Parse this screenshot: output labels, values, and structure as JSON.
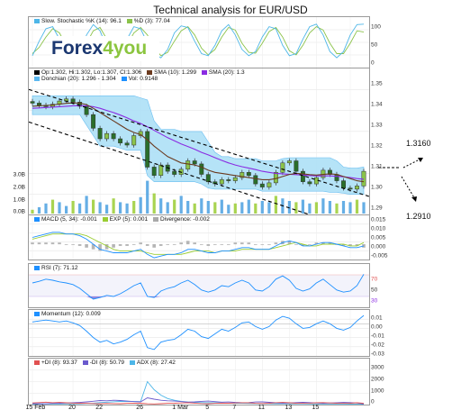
{
  "title": "Technical analysis for EUR/USD",
  "logo": {
    "part1": "Forex",
    "part2": "4you"
  },
  "stochastic": {
    "legend": [
      "Slow. Stochastic %K (14): 96.1",
      "%D (3): 77.04"
    ],
    "colors": [
      "#4db6e8",
      "#8bc34a"
    ],
    "ticks": [
      "100",
      "50",
      "0"
    ],
    "k": [
      20,
      55,
      85,
      90,
      60,
      30,
      15,
      25,
      70,
      95,
      80,
      40,
      20,
      30,
      60,
      90,
      85,
      50,
      25,
      15,
      35,
      75,
      92,
      88,
      55,
      25,
      20,
      45,
      80,
      95,
      70,
      35,
      20,
      30,
      65,
      90,
      85,
      45,
      20,
      25,
      60,
      90,
      96,
      70,
      30,
      15,
      30,
      70,
      95,
      96
    ],
    "d": [
      25,
      40,
      65,
      85,
      75,
      45,
      22,
      20,
      50,
      80,
      88,
      60,
      30,
      25,
      45,
      75,
      88,
      70,
      40,
      20,
      28,
      55,
      80,
      90,
      70,
      38,
      22,
      35,
      65,
      88,
      82,
      50,
      28,
      26,
      50,
      78,
      88,
      65,
      32,
      22,
      45,
      75,
      90,
      82,
      50,
      25,
      25,
      50,
      80,
      77
    ]
  },
  "price": {
    "legend_row1": [
      "Op:1.302, Hi:1.302, Lo:1.307, Cl:1.306",
      "SMA (10): 1.299",
      "SMA (20): 1.3"
    ],
    "legend_row2": [
      "Donchian (20): 1.296 - 1.304",
      "Vol: 0.9148"
    ],
    "legend_colors": [
      "#000000",
      "#6b3a1f",
      "#8a2be2",
      "#5bb8f0",
      "#1e90ff"
    ],
    "ticks": [
      "1.35",
      "1.34",
      "1.33",
      "1.32",
      "1.31",
      "1.30",
      "1.29"
    ],
    "vol_ticks": [
      "3.0B",
      "2.0B",
      "1.0B",
      "0.0B"
    ],
    "close": [
      1.3385,
      1.3375,
      1.3368,
      1.338,
      1.3395,
      1.3405,
      1.339,
      1.337,
      1.333,
      1.3265,
      1.3215,
      1.324,
      1.3215,
      1.3195,
      1.3185,
      1.323,
      1.325,
      1.308,
      1.304,
      1.309,
      1.306,
      1.3045,
      1.307,
      1.311,
      1.3095,
      1.3045,
      1.301,
      1.3,
      1.302,
      1.3015,
      1.303,
      1.3055,
      1.304,
      1.3,
      1.2985,
      1.3005,
      1.3055,
      1.31,
      1.311,
      1.306,
      1.301,
      1.3,
      1.303,
      1.3065,
      1.3045,
      1.3015,
      1.298,
      1.2975,
      1.299,
      1.306
    ],
    "donchian_high": [
      1.342,
      1.342,
      1.342,
      1.342,
      1.342,
      1.342,
      1.342,
      1.342,
      1.342,
      1.342,
      1.342,
      1.342,
      1.342,
      1.342,
      1.342,
      1.342,
      1.341,
      1.34,
      1.33,
      1.326,
      1.326,
      1.326,
      1.325,
      1.325,
      1.325,
      1.325,
      1.32,
      1.315,
      1.313,
      1.313,
      1.312,
      1.312,
      1.312,
      1.312,
      1.311,
      1.311,
      1.311,
      1.312,
      1.3125,
      1.3125,
      1.3125,
      1.3125,
      1.3125,
      1.3125,
      1.3125,
      1.311,
      1.308,
      1.3075,
      1.3075,
      1.308
    ],
    "donchian_low": [
      1.333,
      1.333,
      1.333,
      1.333,
      1.333,
      1.333,
      1.333,
      1.333,
      1.328,
      1.323,
      1.318,
      1.318,
      1.318,
      1.317,
      1.316,
      1.316,
      1.316,
      1.304,
      1.301,
      1.301,
      1.301,
      1.301,
      1.301,
      1.301,
      1.301,
      1.3,
      1.298,
      1.2975,
      1.2975,
      1.2975,
      1.2975,
      1.2975,
      1.2975,
      1.2975,
      1.2965,
      1.2965,
      1.2965,
      1.2965,
      1.2965,
      1.2965,
      1.2965,
      1.2965,
      1.2965,
      1.2965,
      1.296,
      1.296,
      1.2955,
      1.295,
      1.295,
      1.295
    ],
    "sma10": [
      1.337,
      1.3372,
      1.3374,
      1.3376,
      1.338,
      1.3384,
      1.3386,
      1.3385,
      1.3378,
      1.336,
      1.334,
      1.332,
      1.33,
      1.328,
      1.326,
      1.3245,
      1.3235,
      1.321,
      1.318,
      1.3155,
      1.313,
      1.3115,
      1.31,
      1.3095,
      1.309,
      1.308,
      1.3065,
      1.3055,
      1.305,
      1.3045,
      1.304,
      1.3035,
      1.303,
      1.3025,
      1.302,
      1.302,
      1.3025,
      1.3035,
      1.3045,
      1.305,
      1.3048,
      1.3044,
      1.3042,
      1.3045,
      1.3048,
      1.3045,
      1.3035,
      1.3025,
      1.3015,
      1.301
    ],
    "sma20": [
      1.336,
      1.3362,
      1.3364,
      1.3366,
      1.3368,
      1.337,
      1.3372,
      1.3373,
      1.3372,
      1.3368,
      1.336,
      1.335,
      1.334,
      1.3328,
      1.3315,
      1.33,
      1.3288,
      1.3272,
      1.3255,
      1.3238,
      1.322,
      1.3205,
      1.319,
      1.3178,
      1.3165,
      1.315,
      1.3138,
      1.3125,
      1.3112,
      1.31,
      1.309,
      1.3082,
      1.3075,
      1.3068,
      1.306,
      1.3055,
      1.305,
      1.3048,
      1.3046,
      1.3044,
      1.3042,
      1.304,
      1.3038,
      1.3038,
      1.3038,
      1.3036,
      1.3034,
      1.303,
      1.3025,
      1.3022
    ],
    "volume_b": [
      0.3,
      0.5,
      0.8,
      1.1,
      0.9,
      0.6,
      1.0,
      0.8,
      1.4,
      1.1,
      0.9,
      0.7,
      1.2,
      0.9,
      0.8,
      1.0,
      1.3,
      2.6,
      1.6,
      1.2,
      0.9,
      1.1,
      1.4,
      1.0,
      0.8,
      1.2,
      1.0,
      0.9,
      1.1,
      0.7,
      0.8,
      0.9,
      1.1,
      0.8,
      1.0,
      0.9,
      1.4,
      1.2,
      1.0,
      0.9,
      1.1,
      0.8,
      0.9,
      1.2,
      1.0,
      0.8,
      1.0,
      0.9,
      1.1,
      0.9
    ],
    "ylim": [
      1.285,
      1.355
    ],
    "trend_upper": [
      1.345,
      1.294
    ],
    "trend_lower": [
      1.3295,
      1.276
    ],
    "trend_pivot_label": "1.3160",
    "trend_target_label": "1.2910"
  },
  "macd": {
    "legend": [
      "MACD (5, 34): -0.001",
      "EXP (5): 0.001",
      "Divergence: -0.002"
    ],
    "colors": [
      "#1e90ff",
      "#9acd32",
      "#a9a9a9"
    ],
    "ticks": [
      "0.015",
      "0.010",
      "0.005",
      "0.000",
      "-0.005"
    ],
    "macd": [
      0.004,
      0.005,
      0.006,
      0.007,
      0.007,
      0.006,
      0.006,
      0.005,
      0.003,
      0.0,
      -0.003,
      -0.004,
      -0.005,
      -0.005,
      -0.005,
      -0.004,
      -0.003,
      -0.006,
      -0.008,
      -0.007,
      -0.006,
      -0.006,
      -0.005,
      -0.003,
      -0.003,
      -0.004,
      -0.005,
      -0.005,
      -0.004,
      -0.004,
      -0.003,
      -0.002,
      -0.002,
      -0.003,
      -0.003,
      -0.003,
      -0.001,
      0.001,
      0.002,
      0.001,
      -0.001,
      -0.001,
      0.0,
      0.001,
      0.001,
      0.0,
      -0.001,
      -0.002,
      -0.002,
      -0.001
    ],
    "signal": [
      0.003,
      0.004,
      0.005,
      0.006,
      0.006,
      0.006,
      0.006,
      0.006,
      0.005,
      0.003,
      0.001,
      -0.001,
      -0.003,
      -0.004,
      -0.004,
      -0.004,
      -0.004,
      -0.005,
      -0.006,
      -0.006,
      -0.006,
      -0.006,
      -0.006,
      -0.005,
      -0.004,
      -0.004,
      -0.004,
      -0.005,
      -0.004,
      -0.004,
      -0.004,
      -0.003,
      -0.003,
      -0.003,
      -0.003,
      -0.003,
      -0.002,
      -0.001,
      0.0,
      0.001,
      0.0,
      -0.001,
      -0.001,
      0.0,
      0.0,
      0.0,
      0.0,
      -0.001,
      -0.001,
      0.001
    ],
    "divergence": [
      0.001,
      0.001,
      0.001,
      0.001,
      0.001,
      0.0,
      0.0,
      -0.001,
      -0.002,
      -0.003,
      -0.004,
      -0.003,
      -0.002,
      -0.001,
      -0.001,
      0.0,
      0.001,
      -0.001,
      -0.002,
      -0.001,
      0.0,
      0.0,
      0.001,
      0.002,
      0.001,
      0.0,
      -0.001,
      0.0,
      0.0,
      0.0,
      0.001,
      0.001,
      0.001,
      0.0,
      0.0,
      0.0,
      0.001,
      0.002,
      0.002,
      0.0,
      -0.001,
      0.0,
      0.001,
      0.001,
      0.001,
      0.0,
      -0.001,
      -0.001,
      -0.001,
      -0.002
    ],
    "ylim": [
      -0.009,
      0.017
    ]
  },
  "rsi": {
    "legend": [
      "RSI (7): 71.12"
    ],
    "color": "#1e90ff",
    "ticks": [
      "70",
      "50",
      "30"
    ],
    "tick_colors": [
      "#e05050",
      "#333333",
      "#8a2be2"
    ],
    "values": [
      55,
      58,
      62,
      60,
      57,
      55,
      52,
      45,
      35,
      25,
      28,
      32,
      30,
      35,
      42,
      50,
      55,
      30,
      28,
      40,
      45,
      48,
      55,
      60,
      52,
      42,
      38,
      42,
      50,
      48,
      55,
      60,
      55,
      42,
      40,
      48,
      62,
      68,
      60,
      45,
      40,
      44,
      55,
      62,
      52,
      42,
      38,
      40,
      50,
      71
    ],
    "ylim": [
      10,
      90
    ]
  },
  "momentum": {
    "legend": [
      "Momentum (12): 0.009"
    ],
    "color": "#1e90ff",
    "ticks": [
      "0.01",
      "0.00",
      "-0.01",
      "-0.02",
      "-0.03"
    ],
    "values": [
      0.002,
      0.003,
      0.004,
      0.003,
      0.002,
      0.003,
      0.001,
      -0.002,
      -0.008,
      -0.015,
      -0.02,
      -0.018,
      -0.022,
      -0.02,
      -0.017,
      -0.012,
      -0.008,
      -0.026,
      -0.028,
      -0.02,
      -0.018,
      -0.017,
      -0.012,
      -0.006,
      -0.008,
      -0.014,
      -0.016,
      -0.011,
      -0.006,
      -0.008,
      -0.004,
      0.001,
      0.002,
      -0.003,
      -0.006,
      -0.003,
      0.004,
      0.008,
      0.006,
      0.0,
      -0.005,
      -0.004,
      0.0,
      0.003,
      0.0,
      -0.005,
      -0.007,
      -0.004,
      0.003,
      0.009
    ],
    "ylim": [
      -0.035,
      0.015
    ]
  },
  "adx": {
    "legend": [
      "+DI (8): 93.37",
      "-DI (8): 50.79",
      "ADX (8): 27.42"
    ],
    "colors": [
      "#e05050",
      "#6a5acd",
      "#4db6e8"
    ],
    "ticks": [
      "3000",
      "2000",
      "1000",
      "0"
    ],
    "plus_di": [
      120,
      150,
      180,
      140,
      160,
      130,
      110,
      100,
      90,
      80,
      70,
      85,
      75,
      70,
      90,
      110,
      100,
      60,
      50,
      70,
      90,
      100,
      120,
      140,
      110,
      80,
      70,
      90,
      110,
      100,
      120,
      140,
      130,
      90,
      80,
      100,
      140,
      160,
      130,
      100,
      90,
      110,
      130,
      150,
      120,
      100,
      90,
      100,
      130,
      93
    ],
    "minus_di": [
      80,
      70,
      60,
      90,
      100,
      120,
      140,
      160,
      200,
      250,
      300,
      280,
      320,
      300,
      260,
      220,
      200,
      500,
      400,
      320,
      280,
      260,
      220,
      180,
      200,
      240,
      260,
      220,
      180,
      190,
      160,
      140,
      150,
      190,
      200,
      170,
      130,
      110,
      120,
      150,
      170,
      150,
      120,
      100,
      120,
      140,
      160,
      150,
      120,
      50
    ],
    "adx_vals": [
      40,
      42,
      45,
      48,
      50,
      55,
      60,
      70,
      85,
      110,
      150,
      180,
      210,
      230,
      240,
      230,
      220,
      1700,
      1100,
      700,
      450,
      320,
      240,
      190,
      160,
      150,
      140,
      130,
      120,
      110,
      100,
      90,
      85,
      80,
      78,
      75,
      70,
      65,
      62,
      60,
      58,
      55,
      52,
      50,
      48,
      46,
      44,
      42,
      40,
      27
    ],
    "ylim": [
      0,
      3400
    ]
  },
  "x_ticks": [
    {
      "label": "15 Feb",
      "i": 0
    },
    {
      "label": "20",
      "i": 6
    },
    {
      "label": "22",
      "i": 10
    },
    {
      "label": "26",
      "i": 16
    },
    {
      "label": "1 Mar",
      "i": 22
    },
    {
      "label": "5",
      "i": 26
    },
    {
      "label": "7",
      "i": 30
    },
    {
      "label": "11",
      "i": 34
    },
    {
      "label": "13",
      "i": 38
    },
    {
      "label": "15",
      "i": 42
    },
    {
      "label": "",
      "i": 47
    }
  ],
  "chart_data": [
    {
      "type": "line",
      "title": "Technical analysis for EUR/USD",
      "panel": "Stochastic",
      "series": [
        {
          "name": "Slow. Stochastic %K (14): 96.1"
        },
        {
          "name": "%D (3): 77.04"
        }
      ],
      "ylim": [
        0,
        100
      ]
    },
    {
      "type": "candlestick",
      "panel": "Price EUR/USD",
      "ylim": [
        1.285,
        1.355
      ],
      "annotations": [
        "1.3160",
        "1.2910"
      ]
    },
    {
      "type": "line",
      "panel": "MACD",
      "series": [
        {
          "name": "MACD (5, 34): -0.001"
        },
        {
          "name": "EXP (5): 0.001"
        },
        {
          "name": "Divergence: -0.002"
        }
      ]
    },
    {
      "type": "line",
      "panel": "RSI",
      "series": [
        {
          "name": "RSI (7): 71.12"
        }
      ],
      "ylim": [
        10,
        90
      ]
    },
    {
      "type": "line",
      "panel": "Momentum",
      "series": [
        {
          "name": "Momentum (12): 0.009"
        }
      ]
    },
    {
      "type": "line",
      "panel": "ADX",
      "series": [
        {
          "name": "+DI (8): 93.37"
        },
        {
          "name": "-DI (8): 50.79"
        },
        {
          "name": "ADX (8): 27.42"
        }
      ],
      "ylim": [
        0,
        3400
      ]
    }
  ]
}
